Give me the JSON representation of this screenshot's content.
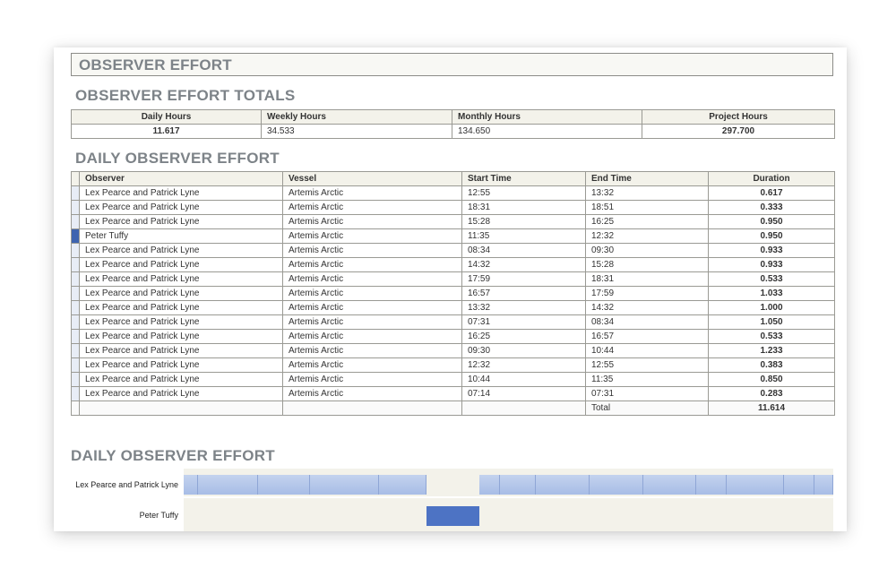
{
  "page_title": "OBSERVER EFFORT",
  "totals": {
    "heading": "OBSERVER EFFORT TOTALS",
    "headers": [
      "Daily Hours",
      "Weekly Hours",
      "Monthly Hours",
      "Project Hours"
    ],
    "values": [
      "11.617",
      "34.533",
      "134.650",
      "297.700"
    ]
  },
  "daily": {
    "heading": "DAILY OBSERVER EFFORT",
    "headers": [
      "Observer",
      "Vessel",
      "Start Time",
      "End Time",
      "Duration"
    ],
    "rows": [
      {
        "observer": "Lex Pearce and Patrick Lyne",
        "vessel": "Artemis Arctic",
        "start": "12:55",
        "end": "13:32",
        "duration": "0.617"
      },
      {
        "observer": "Lex Pearce and Patrick Lyne",
        "vessel": "Artemis Arctic",
        "start": "18:31",
        "end": "18:51",
        "duration": "0.333"
      },
      {
        "observer": "Lex Pearce and Patrick Lyne",
        "vessel": "Artemis Arctic",
        "start": "15:28",
        "end": "16:25",
        "duration": "0.950"
      },
      {
        "observer": "Peter Tuffy",
        "vessel": "Artemis Arctic",
        "start": "11:35",
        "end": "12:32",
        "duration": "0.950"
      },
      {
        "observer": "Lex Pearce and Patrick Lyne",
        "vessel": "Artemis Arctic",
        "start": "08:34",
        "end": "09:30",
        "duration": "0.933"
      },
      {
        "observer": "Lex Pearce and Patrick Lyne",
        "vessel": "Artemis Arctic",
        "start": "14:32",
        "end": "15:28",
        "duration": "0.933"
      },
      {
        "observer": "Lex Pearce and Patrick Lyne",
        "vessel": "Artemis Arctic",
        "start": "17:59",
        "end": "18:31",
        "duration": "0.533"
      },
      {
        "observer": "Lex Pearce and Patrick Lyne",
        "vessel": "Artemis Arctic",
        "start": "16:57",
        "end": "17:59",
        "duration": "1.033"
      },
      {
        "observer": "Lex Pearce and Patrick Lyne",
        "vessel": "Artemis Arctic",
        "start": "13:32",
        "end": "14:32",
        "duration": "1.000"
      },
      {
        "observer": "Lex Pearce and Patrick Lyne",
        "vessel": "Artemis Arctic",
        "start": "07:31",
        "end": "08:34",
        "duration": "1.050"
      },
      {
        "observer": "Lex Pearce and Patrick Lyne",
        "vessel": "Artemis Arctic",
        "start": "16:25",
        "end": "16:57",
        "duration": "0.533"
      },
      {
        "observer": "Lex Pearce and Patrick Lyne",
        "vessel": "Artemis Arctic",
        "start": "09:30",
        "end": "10:44",
        "duration": "1.233"
      },
      {
        "observer": "Lex Pearce and Patrick Lyne",
        "vessel": "Artemis Arctic",
        "start": "12:32",
        "end": "12:55",
        "duration": "0.383"
      },
      {
        "observer": "Lex Pearce and Patrick Lyne",
        "vessel": "Artemis Arctic",
        "start": "10:44",
        "end": "11:35",
        "duration": "0.850"
      },
      {
        "observer": "Lex Pearce and Patrick Lyne",
        "vessel": "Artemis Arctic",
        "start": "07:14",
        "end": "07:31",
        "duration": "0.283"
      }
    ],
    "selected_row": 3,
    "total_label": "Total",
    "total_value": "11.614"
  },
  "gantt": {
    "heading": "DAILY OBSERVER EFFORT",
    "rows": [
      "Lex Pearce and Patrick Lyne",
      "Peter Tuffy"
    ]
  },
  "colors": {
    "selection": "#3e64b0",
    "bar": "#a7bde6",
    "heading": "#7d8388"
  }
}
